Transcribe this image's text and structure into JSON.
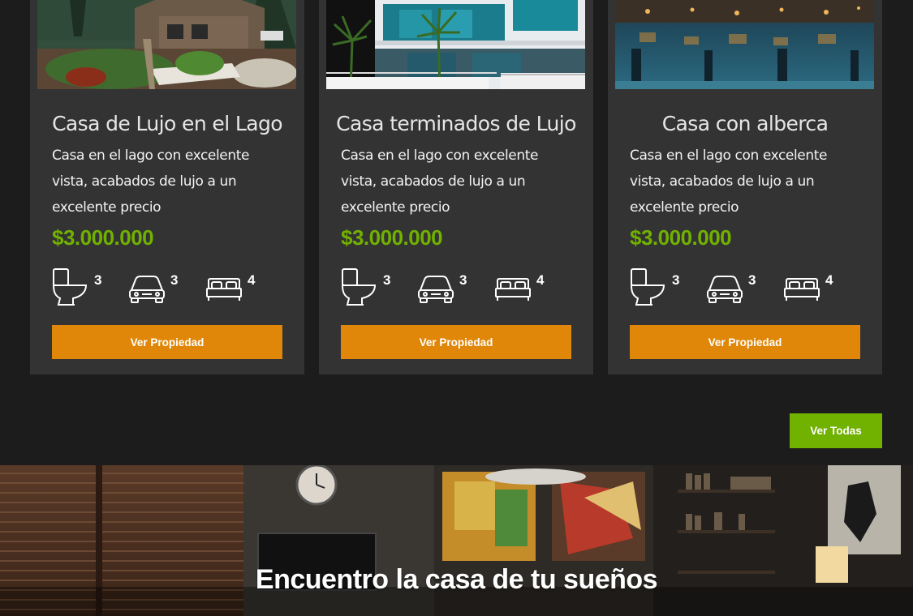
{
  "properties": [
    {
      "title": "Casa de Lujo en el Lago",
      "description": "Casa en el lago con excelente vista, acabados de lujo a un excelente precio",
      "price": "$3.000.000",
      "bathrooms": "3",
      "parking": "3",
      "bedrooms": "4",
      "button_label": "Ver Propiedad"
    },
    {
      "title": "Casa terminados de Lujo",
      "description": "Casa en el lago con excelente vista, acabados de lujo a un excelente precio",
      "price": "$3.000.000",
      "bathrooms": "3",
      "parking": "3",
      "bedrooms": "4",
      "button_label": "Ver Propiedad"
    },
    {
      "title": "Casa con alberca",
      "description": "Casa en el lago con excelente vista, acabados de lujo a un excelente precio",
      "price": "$3.000.000",
      "bathrooms": "3",
      "parking": "3",
      "bedrooms": "4",
      "button_label": "Ver Propiedad"
    }
  ],
  "view_all_label": "Ver Todas",
  "hero": {
    "title": "Encuentro la casa de tu sueños"
  },
  "colors": {
    "background": "#1c1c1c",
    "card": "#333333",
    "price": "#71b100",
    "primary_button": "#e08709",
    "secondary_button": "#71b100"
  },
  "icons": [
    "toilet-icon",
    "car-icon",
    "bed-icon"
  ]
}
